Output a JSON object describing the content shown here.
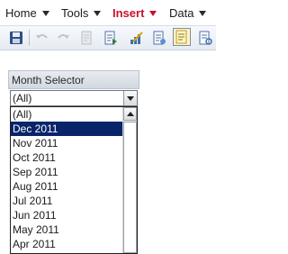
{
  "menubar": {
    "items": [
      {
        "label": "Home"
      },
      {
        "label": "Tools"
      },
      {
        "label": "Insert"
      },
      {
        "label": "Data"
      }
    ]
  },
  "toolbar": {
    "buttons": [
      {
        "icon": "save-icon"
      },
      {
        "icon": "undo-icon"
      },
      {
        "icon": "redo-icon"
      },
      {
        "icon": "page-icon"
      },
      {
        "icon": "insert-page-icon"
      },
      {
        "icon": "chart-edit-icon"
      },
      {
        "icon": "page-edit-icon"
      },
      {
        "icon": "notes-icon"
      },
      {
        "icon": "document-icon"
      }
    ]
  },
  "colors": {
    "active_menu": "#c8102e",
    "selection": "#0a246a"
  },
  "month_selector": {
    "title": "Month Selector",
    "selected_value": "(All)",
    "options": [
      {
        "label": "(All)",
        "selected": false
      },
      {
        "label": "Dec 2011",
        "selected": true
      },
      {
        "label": "Nov 2011",
        "selected": false
      },
      {
        "label": "Oct 2011",
        "selected": false
      },
      {
        "label": "Sep 2011",
        "selected": false
      },
      {
        "label": "Aug 2011",
        "selected": false
      },
      {
        "label": "Jul 2011",
        "selected": false
      },
      {
        "label": "Jun 2011",
        "selected": false
      },
      {
        "label": "May 2011",
        "selected": false
      },
      {
        "label": "Apr 2011",
        "selected": false
      }
    ]
  }
}
